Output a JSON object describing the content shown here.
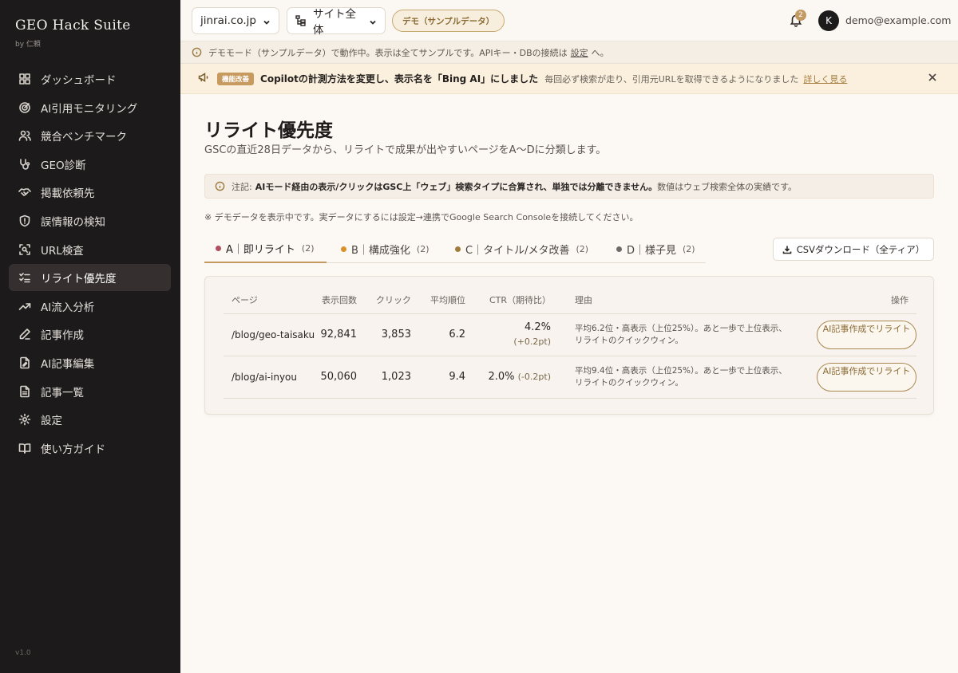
{
  "app": {
    "title": "GEO Hack Suite",
    "subtitle": "by 仁頼",
    "version": "v1.0"
  },
  "sidebar": {
    "items": [
      {
        "label": "ダッシュボード",
        "icon": "dashboard-icon"
      },
      {
        "label": "AI引用モニタリング",
        "icon": "radar-icon"
      },
      {
        "label": "競合ベンチマーク",
        "icon": "users-icon"
      },
      {
        "label": "GEO診断",
        "icon": "stethoscope-icon"
      },
      {
        "label": "掲載依頼先",
        "icon": "handshake-icon"
      },
      {
        "label": "誤情報の検知",
        "icon": "shield-alert-icon"
      },
      {
        "label": "URL検査",
        "icon": "scan-search-icon"
      },
      {
        "label": "リライト優先度",
        "icon": "list-checks-icon",
        "active": true
      },
      {
        "label": "AI流入分析",
        "icon": "trending-up-icon"
      },
      {
        "label": "記事作成",
        "icon": "pencil-icon"
      },
      {
        "label": "AI記事編集",
        "icon": "file-edit-icon"
      },
      {
        "label": "記事一覧",
        "icon": "file-text-icon"
      },
      {
        "label": "設定",
        "icon": "gear-icon"
      },
      {
        "label": "使い方ガイド",
        "icon": "book-icon"
      }
    ]
  },
  "topbar": {
    "domain_select": "jinrai.co.jp",
    "scope_select": "サイト全体",
    "demo_pill": "デモ（サンプルデータ）",
    "notification_count": "2",
    "avatar_initial": "K",
    "user_email": "demo@example.com"
  },
  "demo_bar": {
    "text": "デモモード（サンプルデータ）で動作中。表示は全てサンプルです。APIキー・DBの接続は",
    "link": "設定",
    "suffix": "へ。"
  },
  "update_bar": {
    "tag": "機能改善",
    "title": "Copilotの計測方法を変更し、表示名を「Bing AI」にしました",
    "desc": "毎回必ず検索が走り、引用元URLを取得できるようになりました",
    "link": "詳しく見る"
  },
  "page": {
    "title": "リライト優先度",
    "subtitle": "GSCの直近28日データから、リライトで成果が出やすいページをA〜Dに分類します。",
    "note_prefix": "注記:",
    "note_bold": "AIモード経由の表示/クリックはGSC上「ウェブ」検索タイプに合算され、単独では分離できません。",
    "note_rest": "数値はウェブ検索全体の実績です。",
    "demo_note": "※ デモデータを表示中です。実データにするには設定→連携でGoogle Search Consoleを接続してください。",
    "csv_button": "CSVダウンロード（全ティア）"
  },
  "tabs": [
    {
      "label": "A｜即リライト",
      "count": "(2)",
      "color": "#b0505e",
      "active": true
    },
    {
      "label": "B｜構成強化",
      "count": "(2)",
      "color": "#d9902a"
    },
    {
      "label": "C｜タイトル/メタ改善",
      "count": "(2)",
      "color": "#a07c3a"
    },
    {
      "label": "D｜様子見",
      "count": "(2)",
      "color": "#6e6a68"
    }
  ],
  "table": {
    "headers": {
      "page": "ページ",
      "impressions": "表示回数",
      "clicks": "クリック",
      "position": "平均順位",
      "ctr": "CTR（期待比）",
      "reason": "理由",
      "action": "操作"
    },
    "rows": [
      {
        "page": "/blog/geo-taisaku",
        "impressions": "92,841",
        "clicks": "3,853",
        "position": "6.2",
        "ctr": "4.2%",
        "ctr_delta": "(+0.2pt)",
        "reason": "平均6.2位・高表示（上位25%）。あと一歩で上位表示、リライトのクイックウィン。",
        "action": "AI記事作成でリライト"
      },
      {
        "page": "/blog/ai-inyou",
        "impressions": "50,060",
        "clicks": "1,023",
        "position": "9.4",
        "ctr": "2.0%",
        "ctr_delta": "(-0.2pt)",
        "reason": "平均9.4位・高表示（上位25%）。あと一歩で上位表示、リライトのクイックウィン。",
        "action": "AI記事作成でリライト"
      }
    ]
  }
}
